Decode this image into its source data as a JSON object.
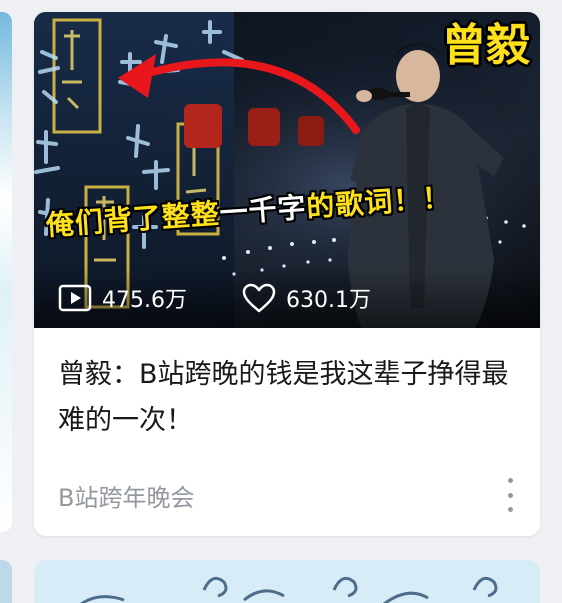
{
  "video": {
    "cover_badge": "曾毅",
    "cover_caption_part1": "俺们背了整整",
    "cover_caption_part2": "一千字",
    "cover_caption_part3": "的歌词！！",
    "plays": "475.6万",
    "likes": "630.1万",
    "title": "曾毅：B站跨晚的钱是我这辈子挣得最难的一次！",
    "uploader": "B站跨年晚会"
  },
  "icons": {
    "play_icon": "play-count-icon",
    "like_icon": "heart-icon",
    "more_icon": "more-vertical-icon"
  },
  "colors": {
    "badge": "#ffe11a",
    "caption_highlight": "#ffe11a",
    "title_text": "#18191c",
    "meta_text": "#9499a0",
    "arrow": "#e8171c"
  }
}
